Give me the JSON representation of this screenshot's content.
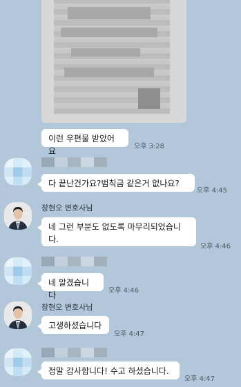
{
  "messages": {
    "m1": {
      "text": "이런 우편물 받았어요",
      "time": "오후 3:28"
    },
    "m2": {
      "text": "다 끝난건가요?범칙금 같은거 없나요?",
      "time": "오후 4:45"
    },
    "m3": {
      "sender": "장현오 변호사님",
      "text": "네 그런 부분도 없도록 마무리되었습니\n다.",
      "time": "오후 4:46"
    },
    "m4": {
      "text": "네 알겠습니다",
      "time": "오후 4:46"
    },
    "m5": {
      "sender": "장현오 변호사님",
      "text": "고생하셨습니다",
      "time": "오후 4:47"
    },
    "m6": {
      "text": "정말 감사합니다! 수고 하셨습니다.",
      "time": "오후 4:47"
    }
  },
  "colors": {
    "background": "#b2c7da",
    "bubble": "#ffffff",
    "suit": "#24303f"
  },
  "icons": {
    "lawyer_avatar": "lawyer-avatar-photo",
    "user_avatar": "blurred-avatar"
  }
}
